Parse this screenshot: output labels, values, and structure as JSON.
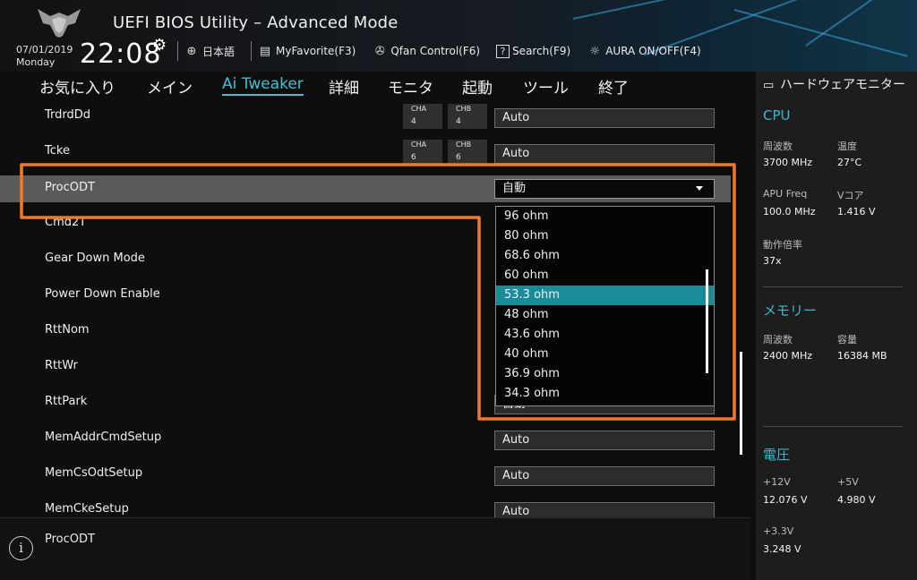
{
  "header": {
    "title": "UEFI BIOS Utility – Advanced Mode",
    "date": "07/01/2019",
    "weekday": "Monday",
    "time": "22:08",
    "toolbar": [
      {
        "icon": "globe-icon",
        "label": "日本語"
      },
      {
        "icon": "favorite-icon",
        "label": "MyFavorite(F3)"
      },
      {
        "icon": "fan-icon",
        "label": "Qfan Control(F6)"
      },
      {
        "icon": "question-icon",
        "label": "Search(F9)"
      },
      {
        "icon": "aura-icon",
        "label": "AURA ON/OFF(F4)"
      }
    ]
  },
  "menu": {
    "tabs": [
      "お気に入り",
      "メイン",
      "Ai Tweaker",
      "詳細",
      "モニタ",
      "起動",
      "ツール",
      "終了"
    ],
    "active": "Ai Tweaker"
  },
  "settings": [
    {
      "label": "TrdrdDd",
      "cha_label": "CHA",
      "cha": "4",
      "chb_label": "CHB",
      "chb": "4",
      "value": "Auto"
    },
    {
      "label": "Tcke",
      "cha_label": "CHA",
      "cha": "6",
      "chb_label": "CHB",
      "chb": "6",
      "value": "Auto"
    },
    {
      "label": "ProcODT",
      "value": "自動"
    },
    {
      "label": "Cmd2T"
    },
    {
      "label": "Gear Down Mode"
    },
    {
      "label": "Power Down Enable"
    },
    {
      "label": "RttNom"
    },
    {
      "label": "RttWr"
    },
    {
      "label": "RttPark",
      "value": "自動"
    },
    {
      "label": "MemAddrCmdSetup",
      "value": "Auto"
    },
    {
      "label": "MemCsOdtSetup",
      "value": "Auto"
    },
    {
      "label": "MemCkeSetup",
      "value": "Auto"
    }
  ],
  "dropdown": {
    "options": [
      "96 ohm",
      "80 ohm",
      "68.6 ohm",
      "60 ohm",
      "53.3 ohm",
      "48 ohm",
      "43.6 ohm",
      "40 ohm",
      "36.9 ohm",
      "34.3 ohm"
    ],
    "highlighted": "53.3 ohm"
  },
  "help": {
    "text": "ProcODT"
  },
  "hw_monitor": {
    "title": "ハードウェアモニター",
    "cpu": {
      "heading": "CPU",
      "freq_label": "周波数",
      "freq": "3700 MHz",
      "temp_label": "温度",
      "temp": "27°C",
      "apu_label": "APU Freq",
      "apu": "100.0 MHz",
      "vcore_label": "Vコア",
      "vcore": "1.416 V",
      "ratio_label": "動作倍率",
      "ratio": "37x"
    },
    "memory": {
      "heading": "メモリー",
      "freq_label": "周波数",
      "freq": "2400 MHz",
      "cap_label": "容量",
      "cap": "16384 MB"
    },
    "voltage": {
      "heading": "電圧",
      "v12_label": "+12V",
      "v12": "12.076 V",
      "v5_label": "+5V",
      "v5": "4.980 V",
      "v33_label": "+3.3V",
      "v33": "3.248 V"
    }
  },
  "colors": {
    "accent": "#3fc1d6",
    "highlight": "#1a8c99",
    "annotation": "#f07a2a",
    "selected_row": "#5a5a5a"
  }
}
